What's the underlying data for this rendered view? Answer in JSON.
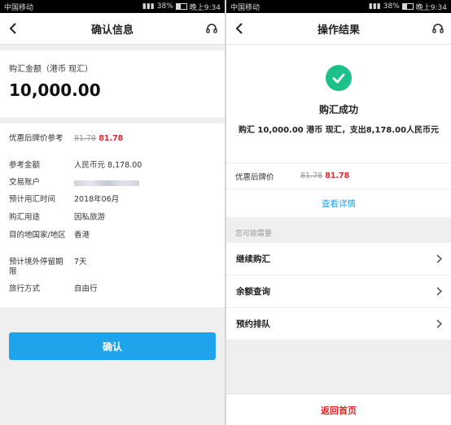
{
  "status_bar": {
    "carrier": "中国移动",
    "battery": "38%",
    "time": "晚上9:34"
  },
  "left": {
    "nav_title": "确认信息",
    "amount_label": "购汇金额（港币 现汇）",
    "amount_value": "10,000.00",
    "rows": [
      {
        "key": "优惠后牌价参考",
        "old": "81.78",
        "new": "81.78"
      },
      {
        "key": "参考金额",
        "value": "人民币元 8,178.00"
      },
      {
        "key": "交易账户",
        "value": ""
      },
      {
        "key": "预计用汇时间",
        "value": "2018年06月"
      },
      {
        "key": "购汇用途",
        "value": "因私旅游"
      },
      {
        "key": "目的地国家/地区",
        "value": "香港"
      },
      {
        "key": "预计境外停留期限",
        "value": "7天"
      },
      {
        "key": "旅行方式",
        "value": "自由行"
      }
    ],
    "confirm_button": "确认"
  },
  "right": {
    "nav_title": "操作结果",
    "result_title": "购汇成功",
    "result_desc": "购汇 10,000.00 港币 现汇，支出8,178.00人民币元",
    "price_label": "优惠后牌价",
    "price_old": "81.78",
    "price_new": "81.78",
    "view_details": "查看详情",
    "section_label": "您可能需要",
    "menu": [
      {
        "label": "继续购汇"
      },
      {
        "label": "余额查询"
      },
      {
        "label": "预约排队"
      }
    ],
    "home_button": "返回首页"
  },
  "colors": {
    "accent_blue": "#1fa3ea",
    "price_red": "#e0262a",
    "success_green": "#1cc18a"
  },
  "icons": [
    "back-arrow-icon",
    "headset-icon",
    "check-icon",
    "chevron-right-icon"
  ]
}
